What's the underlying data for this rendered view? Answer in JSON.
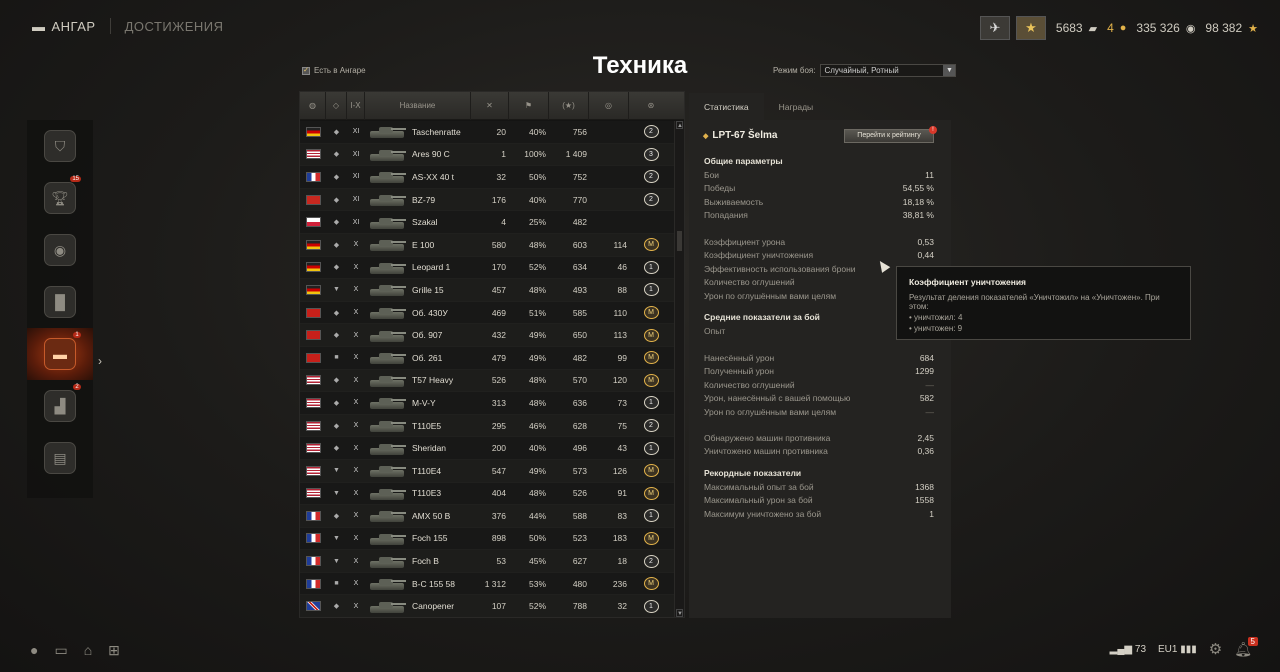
{
  "topnav": {
    "hangar_label": "АНГАР",
    "achievements_label": "ДОСТИЖЕНИЯ",
    "hangar_icon": "garage-icon"
  },
  "currency": {
    "credits_bars": "5683",
    "gold_count": "4",
    "credits": "335 326",
    "free_xp": "98 382"
  },
  "page": {
    "title": "Техника",
    "in_hangar_label": "Есть в Ангаре",
    "mode_label": "Режим боя:",
    "mode_value": "Случайный, Ротный"
  },
  "sidemenu": [
    {
      "name": "wot-logo-icon",
      "badge": ""
    },
    {
      "name": "trophy-icon",
      "badge": "15"
    },
    {
      "name": "medal-icon",
      "badge": ""
    },
    {
      "name": "stats-icon",
      "badge": ""
    },
    {
      "name": "tank-icon",
      "badge": "1",
      "active": true
    },
    {
      "name": "podium-icon",
      "badge": "2"
    },
    {
      "name": "book-icon",
      "badge": ""
    }
  ],
  "table": {
    "headers": {
      "name": "Название"
    },
    "rows": [
      {
        "flag": "de",
        "type": "◆",
        "tier": "XI",
        "name": "Taschenratte",
        "battles": "20",
        "wins": "40%",
        "xp": "756",
        "rating": "",
        "mark": "2"
      },
      {
        "flag": "us",
        "type": "◆",
        "tier": "XI",
        "name": "Ares 90 C",
        "battles": "1",
        "wins": "100%",
        "xp": "1 409",
        "rating": "",
        "mark": "3"
      },
      {
        "flag": "fr",
        "type": "◆",
        "tier": "XI",
        "name": "AS-XX 40 t",
        "battles": "32",
        "wins": "50%",
        "xp": "752",
        "rating": "",
        "mark": "2"
      },
      {
        "flag": "cn",
        "type": "◆",
        "tier": "XI",
        "name": "BZ-79",
        "battles": "176",
        "wins": "40%",
        "xp": "770",
        "rating": "",
        "mark": "2"
      },
      {
        "flag": "pl",
        "type": "◆",
        "tier": "XI",
        "name": "Szakal",
        "battles": "4",
        "wins": "25%",
        "xp": "482",
        "rating": "",
        "mark": ""
      },
      {
        "flag": "de",
        "type": "◆",
        "tier": "X",
        "name": "E 100",
        "battles": "580",
        "wins": "48%",
        "xp": "603",
        "rating": "114",
        "mark": "M"
      },
      {
        "flag": "de",
        "type": "◆",
        "tier": "X",
        "name": "Leopard 1",
        "battles": "170",
        "wins": "52%",
        "xp": "634",
        "rating": "46",
        "mark": "1"
      },
      {
        "flag": "de",
        "type": "▼",
        "tier": "X",
        "name": "Grille 15",
        "battles": "457",
        "wins": "48%",
        "xp": "493",
        "rating": "88",
        "mark": "1"
      },
      {
        "flag": "su",
        "type": "◆",
        "tier": "X",
        "name": "Об. 430У",
        "battles": "469",
        "wins": "51%",
        "xp": "585",
        "rating": "110",
        "mark": "M"
      },
      {
        "flag": "su",
        "type": "◆",
        "tier": "X",
        "name": "Об. 907",
        "battles": "432",
        "wins": "49%",
        "xp": "650",
        "rating": "113",
        "mark": "M"
      },
      {
        "flag": "su",
        "type": "■",
        "tier": "X",
        "name": "Об. 261",
        "battles": "479",
        "wins": "49%",
        "xp": "482",
        "rating": "99",
        "mark": "M"
      },
      {
        "flag": "us",
        "type": "◆",
        "tier": "X",
        "name": "T57 Heavy",
        "battles": "526",
        "wins": "48%",
        "xp": "570",
        "rating": "120",
        "mark": "M"
      },
      {
        "flag": "us",
        "type": "◆",
        "tier": "X",
        "name": "M-V-Y",
        "battles": "313",
        "wins": "48%",
        "xp": "636",
        "rating": "73",
        "mark": "1"
      },
      {
        "flag": "us",
        "type": "◆",
        "tier": "X",
        "name": "T110E5",
        "battles": "295",
        "wins": "46%",
        "xp": "628",
        "rating": "75",
        "mark": "2"
      },
      {
        "flag": "us",
        "type": "◆",
        "tier": "X",
        "name": "Sheridan",
        "battles": "200",
        "wins": "40%",
        "xp": "496",
        "rating": "43",
        "mark": "1"
      },
      {
        "flag": "us",
        "type": "▼",
        "tier": "X",
        "name": "T110E4",
        "battles": "547",
        "wins": "49%",
        "xp": "573",
        "rating": "126",
        "mark": "M"
      },
      {
        "flag": "us",
        "type": "▼",
        "tier": "X",
        "name": "T110E3",
        "battles": "404",
        "wins": "48%",
        "xp": "526",
        "rating": "91",
        "mark": "M"
      },
      {
        "flag": "fr",
        "type": "◆",
        "tier": "X",
        "name": "AMX 50 B",
        "battles": "376",
        "wins": "44%",
        "xp": "588",
        "rating": "83",
        "mark": "1"
      },
      {
        "flag": "fr",
        "type": "▼",
        "tier": "X",
        "name": "Foch 155",
        "battles": "898",
        "wins": "50%",
        "xp": "523",
        "rating": "183",
        "mark": "M"
      },
      {
        "flag": "fr",
        "type": "▼",
        "tier": "X",
        "name": "Foch B",
        "battles": "53",
        "wins": "45%",
        "xp": "627",
        "rating": "18",
        "mark": "2"
      },
      {
        "flag": "fr",
        "type": "■",
        "tier": "X",
        "name": "B-C 155 58",
        "battles": "1 312",
        "wins": "53%",
        "xp": "480",
        "rating": "236",
        "mark": "M"
      },
      {
        "flag": "uk",
        "type": "◆",
        "tier": "X",
        "name": "Canopener",
        "battles": "107",
        "wins": "52%",
        "xp": "788",
        "rating": "32",
        "mark": "1"
      }
    ]
  },
  "tabs": {
    "stats": "Статистика",
    "awards": "Награды"
  },
  "vehicle": {
    "name": "LPT-67 Šelma",
    "rating_button": "Перейти к рейтингу",
    "rating_badge": "!"
  },
  "stats": {
    "general_title": "Общие параметры",
    "general": [
      {
        "k": "Бои",
        "v": "11"
      },
      {
        "k": "Победы",
        "v": "54,55 %"
      },
      {
        "k": "Выживаемость",
        "v": "18,18 %"
      },
      {
        "k": "Попадания",
        "v": "38,81 %"
      }
    ],
    "coef": [
      {
        "k": "Коэффициент урона",
        "v": "0,53"
      },
      {
        "k": "Коэффициент уничтожения",
        "v": "0,44"
      },
      {
        "k": "Эффективность использования брони",
        "v": ""
      },
      {
        "k": "Количество оглушений",
        "v": ""
      },
      {
        "k": "Урон по оглушённым вами целям",
        "v": ""
      }
    ],
    "avg_title": "Средние показатели за бой",
    "avg_xp": {
      "k": "Опыт",
      "v": ""
    },
    "avg_damage": [
      {
        "k": "Нанесённый урон",
        "v": "684"
      },
      {
        "k": "Полученный урон",
        "v": "1299"
      },
      {
        "k": "Количество оглушений",
        "v": "—"
      },
      {
        "k": "Урон, нанесённый с вашей помощью",
        "v": "582"
      },
      {
        "k": "Урон по оглушённым вами целям",
        "v": "—"
      }
    ],
    "avg_spot": [
      {
        "k": "Обнаружено машин противника",
        "v": "2,45"
      },
      {
        "k": "Уничтожено машин противника",
        "v": "0,36"
      }
    ],
    "records_title": "Рекордные показатели",
    "records": [
      {
        "k": "Максимальный опыт за бой",
        "v": "1368"
      },
      {
        "k": "Максимальный урон за бой",
        "v": "1558"
      },
      {
        "k": "Максимум уничтожено за бой",
        "v": "1"
      }
    ]
  },
  "tooltip": {
    "title": "Коэффициент уничтожения",
    "desc": "Результат деления показателей «Уничтожил» на «Уничтожен». При этом:",
    "line1": "• уничтожил: 4",
    "line2": "• уничтожен: 9"
  },
  "bottom": {
    "ping": "73",
    "server": "EU1",
    "notifications": "5"
  }
}
